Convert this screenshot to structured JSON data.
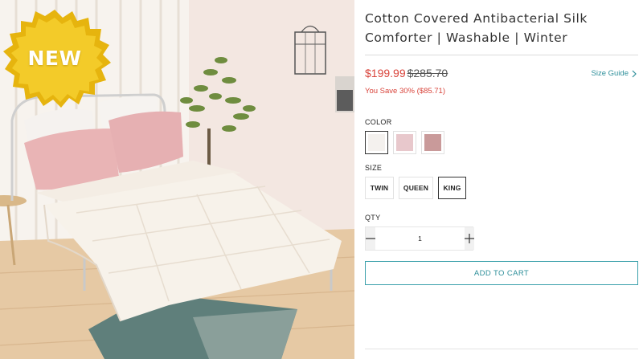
{
  "badge": {
    "text": "NEW"
  },
  "product": {
    "title": "Cotton Covered Antibacterial Silk Comforter | Washable | Winter",
    "price_sale": "$199.99",
    "price_original": "$285.70",
    "you_save": "You Save 30% ($85.71)",
    "size_guide_label": "Size Guide"
  },
  "options": {
    "color_label": "COLOR",
    "colors": [
      "#f4f1ee",
      "#e8c8cc",
      "#c99a9a"
    ],
    "size_label": "SIZE",
    "sizes": [
      "TWIN",
      "QUEEN",
      "KING"
    ],
    "selected_size": "KING",
    "qty_label": "QTY",
    "qty_value": "1"
  },
  "cart": {
    "add_label": "ADD TO CART"
  },
  "theme": {
    "accent": "#2e8f9a",
    "sale": "#d9443b"
  }
}
